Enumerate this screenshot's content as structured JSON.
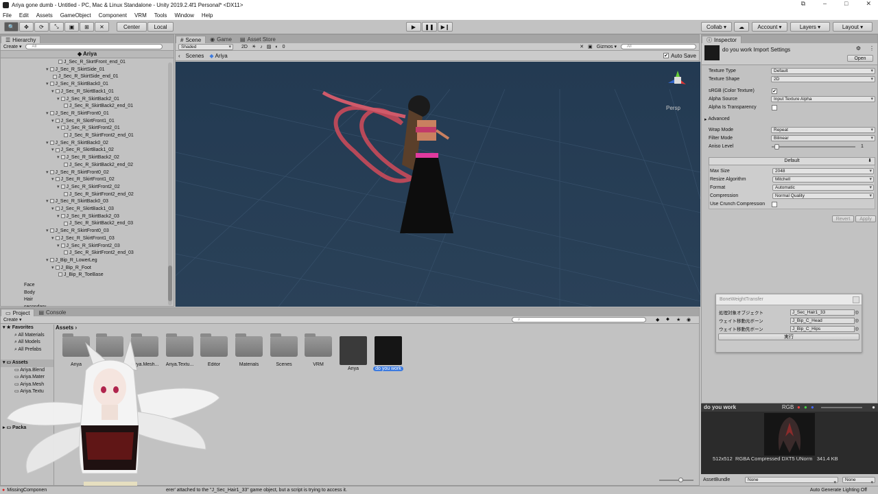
{
  "window": {
    "title": "Ariya gone dumb - Untitled - PC, Mac & Linux Standalone - Unity 2019.2.4f1 Personal* <DX11>"
  },
  "menu": [
    "File",
    "Edit",
    "Assets",
    "GameObject",
    "Component",
    "VRM",
    "Tools",
    "Window",
    "Help"
  ],
  "toolbar": {
    "center": "Center",
    "local": "Local",
    "collab": "Collab",
    "account": "Account",
    "layers": "Layers",
    "layout": "Layout"
  },
  "hierarchy": {
    "tab": "Hierarchy",
    "create": "Create",
    "search_placeholder": "All",
    "scene_name": "Ariya",
    "items": [
      {
        "label": "J_Sec_R_SkirtFront_end_01",
        "depth": 4,
        "expanded": false
      },
      {
        "label": "J_Sec_R_SkirtSide_01",
        "depth": 2,
        "expanded": true
      },
      {
        "label": "J_Sec_R_SkirtSide_end_01",
        "depth": 3,
        "expanded": false
      },
      {
        "label": "J_Sec_R_SkirtBack0_01",
        "depth": 2,
        "expanded": true
      },
      {
        "label": "J_Sec_R_SkirtBack1_01",
        "depth": 3,
        "expanded": true
      },
      {
        "label": "J_Sec_R_SkirtBack2_01",
        "depth": 4,
        "expanded": true
      },
      {
        "label": "J_Sec_R_SkirtBack2_end_01",
        "depth": 5,
        "expanded": false
      },
      {
        "label": "J_Sec_R_SkirtFront0_01",
        "depth": 2,
        "expanded": true
      },
      {
        "label": "J_Sec_R_SkirtFront1_01",
        "depth": 3,
        "expanded": true
      },
      {
        "label": "J_Sec_R_SkirtFront2_01",
        "depth": 4,
        "expanded": true
      },
      {
        "label": "J_Sec_R_SkirtFront2_end_01",
        "depth": 5,
        "expanded": false
      },
      {
        "label": "J_Sec_R_SkirtBack0_02",
        "depth": 2,
        "expanded": true
      },
      {
        "label": "J_Sec_R_SkirtBack1_02",
        "depth": 3,
        "expanded": true
      },
      {
        "label": "J_Sec_R_SkirtBack2_02",
        "depth": 4,
        "expanded": true
      },
      {
        "label": "J_Sec_R_SkirtBack2_end_02",
        "depth": 5,
        "expanded": false
      },
      {
        "label": "J_Sec_R_SkirtFront0_02",
        "depth": 2,
        "expanded": true
      },
      {
        "label": "J_Sec_R_SkirtFront1_02",
        "depth": 3,
        "expanded": true
      },
      {
        "label": "J_Sec_R_SkirtFront2_02",
        "depth": 4,
        "expanded": true
      },
      {
        "label": "J_Sec_R_SkirtFront2_end_02",
        "depth": 5,
        "expanded": false
      },
      {
        "label": "J_Sec_R_SkirtBack0_03",
        "depth": 2,
        "expanded": true
      },
      {
        "label": "J_Sec_R_SkirtBack1_03",
        "depth": 3,
        "expanded": true
      },
      {
        "label": "J_Sec_R_SkirtBack2_03",
        "depth": 4,
        "expanded": true
      },
      {
        "label": "J_Sec_R_SkirtBack2_end_03",
        "depth": 5,
        "expanded": false
      },
      {
        "label": "J_Sec_R_SkirtFront0_03",
        "depth": 2,
        "expanded": true
      },
      {
        "label": "J_Sec_R_SkirtFront1_03",
        "depth": 3,
        "expanded": true
      },
      {
        "label": "J_Sec_R_SkirtFront2_03",
        "depth": 4,
        "expanded": true
      },
      {
        "label": "J_Sec_R_SkirtFront2_end_03",
        "depth": 5,
        "expanded": false
      },
      {
        "label": "J_Bip_R_LowerLeg",
        "depth": 2,
        "expanded": true
      },
      {
        "label": "J_Bip_R_Foot",
        "depth": 3,
        "expanded": true
      },
      {
        "label": "J_Bip_R_ToeBase",
        "depth": 4,
        "expanded": false
      },
      {
        "label": "Face",
        "depth": 0,
        "expanded": false
      },
      {
        "label": "Body",
        "depth": 0,
        "expanded": false
      },
      {
        "label": "Hair",
        "depth": 0,
        "expanded": false
      },
      {
        "label": "secondary",
        "depth": 0,
        "expanded": false
      }
    ]
  },
  "scene": {
    "tabs": [
      "Scene",
      "Game",
      "Asset Store"
    ],
    "shading": "Shaded",
    "mode_2d": "2D",
    "gizmos": "Gizmos",
    "search_placeholder": "All",
    "audio_count": "0",
    "breadcrumb": [
      "Scenes",
      "Ariya"
    ],
    "auto_save": "Auto Save",
    "persp": "Persp",
    "background_color": "#27405a"
  },
  "inspector": {
    "tab": "Inspector",
    "title": "do you work Import Settings",
    "open": "Open",
    "fields": [
      {
        "label": "Texture Type",
        "value": "Default"
      },
      {
        "label": "Texture Shape",
        "value": "2D"
      }
    ],
    "srgb_label": "sRGB (Color Texture)",
    "srgb_checked": true,
    "alpha_source_label": "Alpha Source",
    "alpha_source": "Input Texture Alpha",
    "alpha_transparency_label": "Alpha Is Transparency",
    "advanced": "Advanced",
    "wrap_mode_label": "Wrap Mode",
    "wrap_mode": "Repeat",
    "filter_mode_label": "Filter Mode",
    "filter_mode": "Bilinear",
    "aniso_label": "Aniso Level",
    "aniso_value": "1",
    "platform_tab": "Default",
    "platform_fields": [
      {
        "label": "Max Size",
        "value": "2048"
      },
      {
        "label": "Resize Algorithm",
        "value": "Mitchell"
      },
      {
        "label": "Format",
        "value": "Automatic"
      },
      {
        "label": "Compression",
        "value": "Normal Quality"
      }
    ],
    "crunch_label": "Use Crunch Compression",
    "revert": "Revert",
    "apply": "Apply"
  },
  "bone_weight": {
    "title": "BoneWeightTransfer",
    "rows": [
      {
        "label": "処理対象オブジェクト",
        "value": "J_Sec_Hair1_33"
      },
      {
        "label": "ウェイト移動元ボーン",
        "value": "J_Bip_C_Head"
      },
      {
        "label": "ウェイト移動先ボーン",
        "value": "J_Bip_C_Hips"
      }
    ],
    "run": "実行"
  },
  "project": {
    "tabs": [
      "Project",
      "Console"
    ],
    "create": "Create",
    "favorites": "Favorites",
    "favorite_items": [
      "All Materials",
      "All Models",
      "All Prefabs"
    ],
    "assets_root": "Assets",
    "tree_items": [
      "Ariya.Blend",
      "Ariya.Mater",
      "Ariya.Mesh",
      "Ariya.Textu"
    ],
    "packages": "Packa",
    "breadcrumb": "Assets",
    "assets": [
      {
        "name": "Ariya",
        "kind": "folder"
      },
      {
        "name": "",
        "kind": "folder"
      },
      {
        "name": "Ariya.Mesh...",
        "kind": "folder"
      },
      {
        "name": "Ariya.Textu...",
        "kind": "folder"
      },
      {
        "name": "Editor",
        "kind": "folder"
      },
      {
        "name": "Materials",
        "kind": "folder"
      },
      {
        "name": "Scenes",
        "kind": "folder"
      },
      {
        "name": "VRM",
        "kind": "folder"
      },
      {
        "name": "Ariya",
        "kind": "prefab"
      },
      {
        "name": "do you work",
        "kind": "texture",
        "selected": true
      }
    ]
  },
  "preview": {
    "title": "do you work",
    "channels": "RGB",
    "info": "512x512  RGBA Compressed DXT5 UNorm   341.4 KB",
    "asset_bundle_label": "AssetBundle",
    "bundle_none": "None",
    "variant_none": "None"
  },
  "status": {
    "message_start": "MissingComponen",
    "message_end": "erer' attached to the \"J_Sec_Hair1_33\" game object, but a script is trying to access it.",
    "lighting": "Auto Generate Lighting Off"
  },
  "colors": {
    "selection": "#3d7be0",
    "hair": "#c94a5a",
    "error": "#d22"
  }
}
